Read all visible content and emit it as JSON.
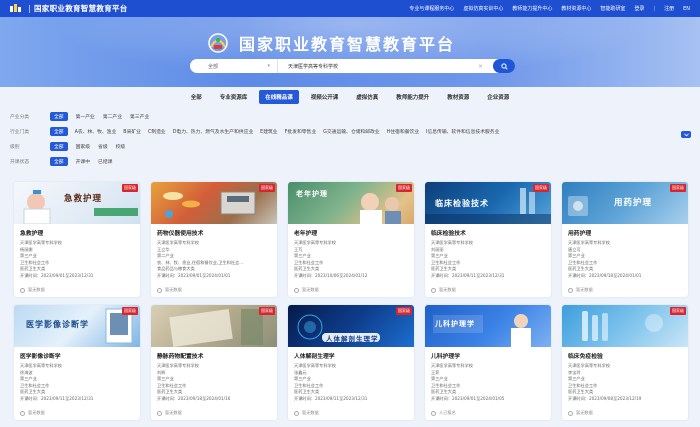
{
  "topbar": {
    "site_name": "国家职业教育智慧教育平台",
    "nav": [
      "专业与课程服务中心",
      "虚拟仿真实训中心",
      "教师能力提升中心",
      "教材资源中心",
      "智能助研室",
      "登录",
      "注册",
      "EN"
    ]
  },
  "hero": {
    "title": "国家职业教育智慧教育平台"
  },
  "search": {
    "scope": "全部",
    "value": "天津医学高等专科学校"
  },
  "tabs": [
    {
      "label": "全部",
      "active": false
    },
    {
      "label": "专业资源库",
      "active": false
    },
    {
      "label": "在线精品课",
      "active": true
    },
    {
      "label": "视频公开课",
      "active": false
    },
    {
      "label": "虚拟仿真",
      "active": false
    },
    {
      "label": "教师能力提升",
      "active": false
    },
    {
      "label": "教材资源",
      "active": false
    },
    {
      "label": "企业资源",
      "active": false
    }
  ],
  "filters": [
    {
      "label": "产业分类",
      "options": [
        "全部",
        "第一产业",
        "第二产业",
        "第三产业"
      ]
    },
    {
      "label": "行业门类",
      "options": [
        "全部",
        "A农、林、牧、渔业",
        "B采矿业",
        "C制造业",
        "D电力、热力、燃气及水生产和供应业",
        "E建筑业",
        "F批发和零售业",
        "G交通运输、仓储和邮政业",
        "H住宿和餐饮业",
        "I信息传输、软件和信息技术服务业"
      ]
    },
    {
      "label": "级别",
      "options": [
        "全部",
        "国家级",
        "省级",
        "校级"
      ]
    },
    {
      "label": "开课状态",
      "options": [
        "全部",
        "开课中",
        "已结课"
      ]
    }
  ],
  "cards": [
    {
      "title": "急救护理",
      "badge": "国家级",
      "thumb_text": "急救护理",
      "school": "天津医学高等专科学校",
      "teacher": "杨丽娜",
      "industry": "第三产业",
      "sector": "卫生和社会工作",
      "category": "医药卫生大类",
      "period": "开课时间：2023/09/01至2023/12/31",
      "status": "暂无数据"
    },
    {
      "title": "药物仪器使用技术",
      "badge": "国家级",
      "thumb_text": "",
      "school": "天津医学高等专科学校",
      "teacher": "王立华",
      "industry": "第二产业",
      "sector": "农、林、牧、渔业,住宿和餐饮业,卫生和社会...",
      "category": "食品药品与粮食大类",
      "period": "开课时间：2023/09/01至2024/01/01",
      "status": "暂无数据"
    },
    {
      "title": "老年护理",
      "badge": "国家级",
      "thumb_text": "老年护理",
      "school": "天津医学高等专科学校",
      "teacher": "王芃",
      "industry": "第三产业",
      "sector": "卫生和社会工作",
      "category": "医药卫生大类",
      "period": "开课时间：2023/10/06至2024/01/12",
      "status": "暂无数据"
    },
    {
      "title": "临床检验技术",
      "badge": "国家级",
      "thumb_text": "临床检验技术",
      "school": "天津医学高等专科学校",
      "teacher": "刘丽丽",
      "industry": "第三产业",
      "sector": "卫生和社会工作",
      "category": "医药卫生大类",
      "period": "开课时间：2023/09/11至2023/12/31",
      "status": "暂无数据"
    },
    {
      "title": "用药护理",
      "badge": "国家级",
      "thumb_text": "用药护理",
      "school": "天津医学高等专科学校",
      "teacher": "唐立可",
      "industry": "第三产业",
      "sector": "卫生和社会工作",
      "category": "医药卫生大类",
      "period": "开课时间：2023/09/18至2024/01/01",
      "status": "暂无数据"
    },
    {
      "title": "医学影像诊断学",
      "badge": "国家级",
      "thumb_text": "医学影像诊断学",
      "school": "天津医学高等专科学校",
      "teacher": "徐海波",
      "industry": "第三产业",
      "sector": "卫生和社会工作",
      "category": "医药卫生大类",
      "period": "开课时间：2023/09/11至2023/12/31",
      "status": "暂无数据"
    },
    {
      "title": "静脉药物配置技术",
      "badge": "国家级",
      "thumb_text": "",
      "school": "天津医学高等专科学校",
      "teacher": "刘辉",
      "industry": "第三产业",
      "sector": "卫生和社会工作",
      "category": "医药卫生大类",
      "period": "开课时间：2023/09/18至2024/01/16",
      "status": "暂无数据"
    },
    {
      "title": "人体解剖生理学",
      "badge": "国家级",
      "thumb_text": "人体解剖生理学",
      "school": "天津医学高等专科学校",
      "teacher": "张鑫元",
      "industry": "第三产业",
      "sector": "卫生和社会工作",
      "category": "医药卫生大类",
      "period": "开课时间：2023/09/11至2023/12/31",
      "status": "暂无数据"
    },
    {
      "title": "儿科护理学",
      "badge": "国家级",
      "thumb_text": "儿科护理学",
      "school": "天津医学高等专科学校",
      "teacher": "王菲",
      "industry": "第三产业",
      "sector": "卫生和社会工作",
      "category": "医药卫生大类",
      "period": "开课时间：2023/09/01至2024/01/05",
      "status": "人已报名"
    },
    {
      "title": "临床免疫检验",
      "badge": "国家级",
      "thumb_text": "",
      "school": "天津医学高等专科学校",
      "teacher": "李宝玲",
      "industry": "第三产业",
      "sector": "卫生和社会工作",
      "category": "医药卫生大类",
      "period": "开课时间：2023/09/08至2023/12/19",
      "status": "暂无数据"
    }
  ],
  "colors": {
    "primary": "#2459d8",
    "badge": "#d7262e",
    "topbar": "#1f4fd1"
  }
}
